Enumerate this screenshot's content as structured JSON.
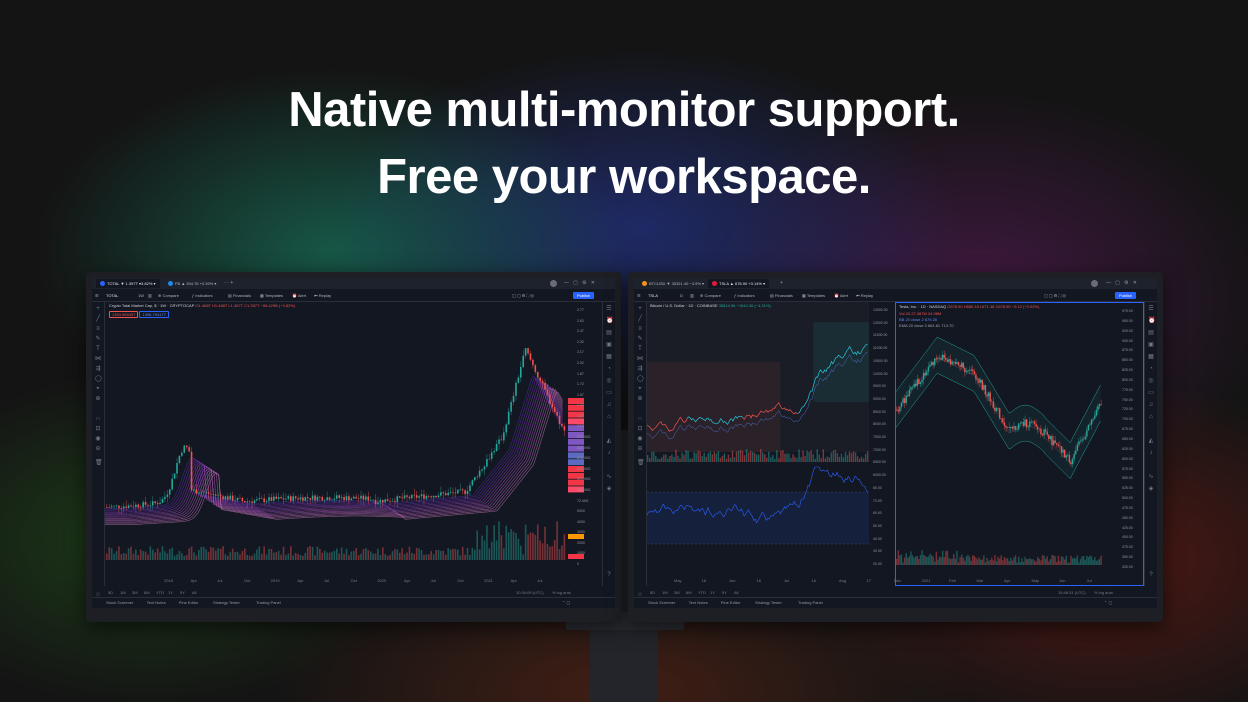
{
  "hero": {
    "line1": "Native multi-monitor support.",
    "line2": "Free your workspace."
  },
  "colors": {
    "up": "#26a69a",
    "down": "#ef5350",
    "accent": "#2962ff",
    "panel": "#131722"
  },
  "left_window": {
    "tabs": [
      {
        "label": "TOTAL ▼ 1.397T ▾3.82% ▾",
        "dot": "#2962ff"
      },
      {
        "label": "FB ▲ 394.76 +0.39% ▾",
        "dot": "#1e88e5"
      }
    ],
    "symbol": "TOTAL",
    "toolbar": [
      "Compare",
      "Indicators",
      "Financials",
      "Templates",
      "Alert",
      "Replay"
    ],
    "publish_label": "Publish",
    "legend_title": "Crypto Total Market Cap, $ · 1W · CRYPTOCAP",
    "legend_values": "O1.468T H1.488T L1.367T C1.397T −56.429B (−3.82%)",
    "legend_badges": [
      "1394.965497",
      "1396.794177"
    ],
    "price_axis": [
      "2.77",
      "2.62",
      "2.47",
      "2.32",
      "2.17",
      "2.02",
      "1.87",
      "1.72",
      "1.57",
      "1.42",
      "1.27",
      "1.12",
      "972.49G",
      "822.49G",
      "672.49G",
      "522.49G",
      "372.49G",
      "222.49G",
      "72.49G",
      "5000",
      "4000",
      "3000",
      "2000",
      "1000",
      "0"
    ],
    "time_labels": [
      "2018",
      "Apr",
      "Jul",
      "Oct",
      "2019",
      "Apr",
      "Jul",
      "Oct",
      "2020",
      "Apr",
      "Jul",
      "Oct",
      "2021",
      "Apr",
      "Jul"
    ],
    "ranges": [
      "5D",
      "1M",
      "3M",
      "6M",
      "YTD",
      "1Y",
      "5Y",
      "All"
    ],
    "clock": "10:34:09 (UTC)",
    "footer": [
      "Stock Screener",
      "Text Notes",
      "Pine Editor",
      "Strategy Tester",
      "Trading Panel"
    ]
  },
  "right_window": {
    "tabs": [
      {
        "label": "BTCUSD ▼ 35321.40 −3.9% ▾",
        "dot": "#f7931a"
      },
      {
        "label": "TSLA ▲ 678.90 +3.14% ▾",
        "dot": "#e31937"
      }
    ],
    "symbol": "TSLA",
    "toolbar": [
      "Compare",
      "Indicators",
      "Financials",
      "Templates",
      "Alert",
      "Replay"
    ],
    "publish_label": "Publish",
    "left_pane": {
      "title": "Bitcoin / U.S. Dollar · 1D · COINBASE",
      "values": "35814.96 −1544.36 (−4.31%)",
      "axis": [
        "13000.00",
        "12000.00",
        "11500.00",
        "11000.00",
        "10500.00",
        "10000.00",
        "9500.00",
        "9000.00",
        "8500.00",
        "8000.00",
        "7500.00",
        "7000.00",
        "6500.00",
        "6000.00",
        "80.00",
        "70.00",
        "60.00",
        "50.00",
        "40.00",
        "30.00",
        "20.00"
      ],
      "time_labels": [
        "May",
        "16",
        "Jun",
        "16",
        "Jul",
        "16",
        "Aug",
        "17"
      ]
    },
    "right_pane": {
      "title": "Tesla, Inc. · 1D · NASDAQ",
      "values": "O678.90 H680.18 L671.38 C678.90 −0.12 (−0.02%)",
      "indicators": [
        "Vol 20  27.387M  24.98M",
        "BB 20 close 2  679.28",
        "EMA 20 close 0  664.81  713.70"
      ],
      "axis": [
        "975.00",
        "950.00",
        "925.00",
        "900.00",
        "875.00",
        "850.00",
        "825.00",
        "800.00",
        "775.00",
        "750.00",
        "725.00",
        "700.00",
        "675.00",
        "650.00",
        "625.00",
        "600.00",
        "575.00",
        "550.00",
        "525.00",
        "500.00",
        "475.00",
        "450.00",
        "425.00",
        "400.00",
        "375.00",
        "350.00",
        "325.00"
      ],
      "time_labels": [
        "Dec",
        "2021",
        "Feb",
        "Mar",
        "Apr",
        "May",
        "Jun",
        "Jul"
      ]
    },
    "ranges": [
      "5D",
      "1M",
      "3M",
      "6M",
      "YTD",
      "1Y",
      "5Y",
      "All"
    ],
    "clock": "15:48:31 (UTC)",
    "footer": [
      "Stock Screener",
      "Text Notes",
      "Pine Editor",
      "Strategy Tester",
      "Trading Panel"
    ]
  }
}
